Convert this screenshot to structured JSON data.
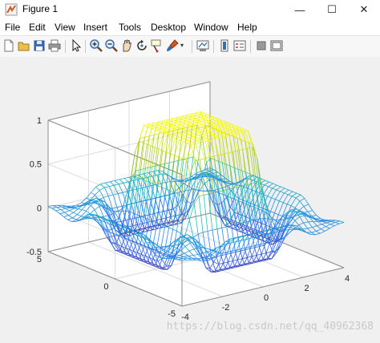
{
  "window": {
    "title": "Figure 1",
    "minimize_glyph": "—",
    "maximize_glyph": "☐",
    "close_glyph": "✕"
  },
  "menu": {
    "items": [
      {
        "label": "File"
      },
      {
        "label": "Edit"
      },
      {
        "label": "View"
      },
      {
        "label": "Insert"
      },
      {
        "label": "Tools"
      },
      {
        "label": "Desktop"
      },
      {
        "label": "Window"
      },
      {
        "label": "Help"
      }
    ]
  },
  "toolbar": {
    "icons": [
      "new-figure-icon",
      "open-file-icon",
      "save-icon",
      "print-icon",
      "pointer-icon",
      "zoom-in-icon",
      "zoom-out-icon",
      "pan-icon",
      "rotate-3d-icon",
      "data-cursor-icon",
      "brush-icon",
      "brush-dropdown-icon",
      "link-plot-icon",
      "insert-colorbar-icon",
      "insert-legend-icon",
      "hide-plot-tools-icon",
      "show-plot-tools-icon"
    ]
  },
  "chart_data": {
    "type": "mesh",
    "xlim": [
      -4,
      4
    ],
    "ylim": [
      -5,
      5
    ],
    "zlim": [
      -0.5,
      1
    ],
    "x_tick_labels": [
      "-4",
      "-2",
      "0",
      "2",
      "4"
    ],
    "y_tick_labels": [
      "-5",
      "0",
      "5"
    ],
    "z_tick_labels": [
      "-0.5",
      "0",
      "0.5",
      "1"
    ],
    "grid": true,
    "colormap": "parula",
    "colors": {
      "low": "#3e26a8",
      "mid": "#1fbfb8",
      "high": "#f9fb0e"
    }
  },
  "watermark": "https://blog.csdn.net/qq_40962368"
}
